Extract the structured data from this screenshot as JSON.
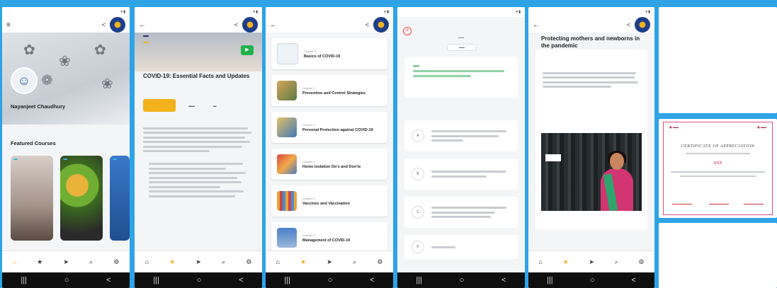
{
  "colors": {
    "accent": "#f2b21b",
    "brand_blue": "#1d3f8a",
    "frame": "#2ea3e6",
    "green": "#21b14b"
  },
  "status_time": "",
  "nav": {
    "items": [
      {
        "icon": "home-icon",
        "glyph": "⌂"
      },
      {
        "icon": "star-icon",
        "glyph": "★"
      },
      {
        "icon": "send-icon",
        "glyph": "➤"
      },
      {
        "icon": "search-icon",
        "glyph": "⌕"
      },
      {
        "icon": "settings-icon",
        "glyph": "⚙"
      }
    ]
  },
  "profile": {
    "name": "Nayanjeet Chaudhury",
    "featured": "Featured Courses"
  },
  "course": {
    "title": "COVID-19: Essential Facts and Updates"
  },
  "chapters": [
    {
      "label": "Chapter 1",
      "name": "Basics of COVID-19"
    },
    {
      "label": "Chapter 2",
      "name": "Prevention and Control Strategies"
    },
    {
      "label": "Chapter 3",
      "name": "Personal Protection against COVID-19"
    },
    {
      "label": "Chapter 4",
      "name": "Home Isolation Do's and Don'ts"
    },
    {
      "label": "Chapter 5",
      "name": "Vaccines and Vaccination"
    },
    {
      "label": "Chapter 6",
      "name": "Management of COVID-19"
    }
  ],
  "quiz": {
    "options": [
      "A",
      "B",
      "C",
      "D"
    ]
  },
  "lesson": {
    "title": "Protecting mothers and newborns in the pandemic"
  },
  "certificate": {
    "title": "CERTIFICATE OF APPRECIATION",
    "name": "XXX"
  }
}
